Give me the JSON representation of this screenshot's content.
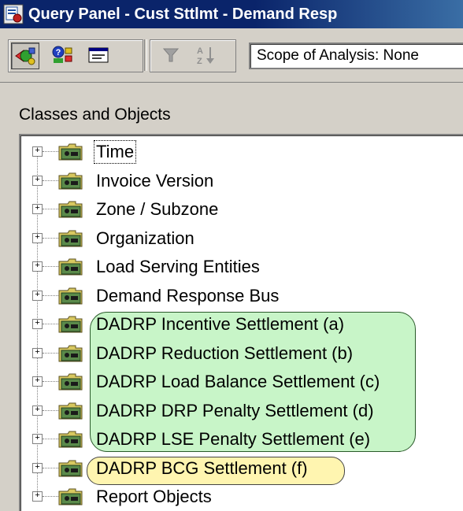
{
  "window": {
    "title": "Query Panel - Cust Sttlmt - Demand Resp"
  },
  "toolbar": {
    "buttons": [
      {
        "name": "objects-view-icon",
        "state": "pressed"
      },
      {
        "name": "user-objects-icon",
        "state": "normal"
      },
      {
        "name": "sql-view-icon",
        "state": "normal"
      },
      {
        "name": "filter-icon",
        "state": "disabled"
      },
      {
        "name": "sort-icon",
        "state": "disabled"
      }
    ],
    "scope_text": "Scope of Analysis: None"
  },
  "panel": {
    "label": "Classes and Objects"
  },
  "tree": {
    "items": [
      {
        "label": "Time",
        "focused": true
      },
      {
        "label": "Invoice Version"
      },
      {
        "label": "Zone / Subzone"
      },
      {
        "label": "Organization"
      },
      {
        "label": "Load Serving Entities"
      },
      {
        "label": "Demand Response Bus"
      },
      {
        "label": "DADRP Incentive Settlement (a)",
        "highlight": "green"
      },
      {
        "label": "DADRP Reduction Settlement (b)",
        "highlight": "green"
      },
      {
        "label": "DADRP Load Balance Settlement (c)",
        "highlight": "green"
      },
      {
        "label": "DADRP DRP Penalty Settlement (d)",
        "highlight": "green"
      },
      {
        "label": "DADRP LSE Penalty Settlement (e)",
        "highlight": "green"
      },
      {
        "label": "DADRP BCG Settlement (f)",
        "highlight": "yellow"
      },
      {
        "label": "Report Objects"
      }
    ]
  },
  "colors": {
    "titlebar": "#0a246a",
    "green_highlight": "#c8f5c8",
    "yellow_highlight": "#fff5b0"
  }
}
